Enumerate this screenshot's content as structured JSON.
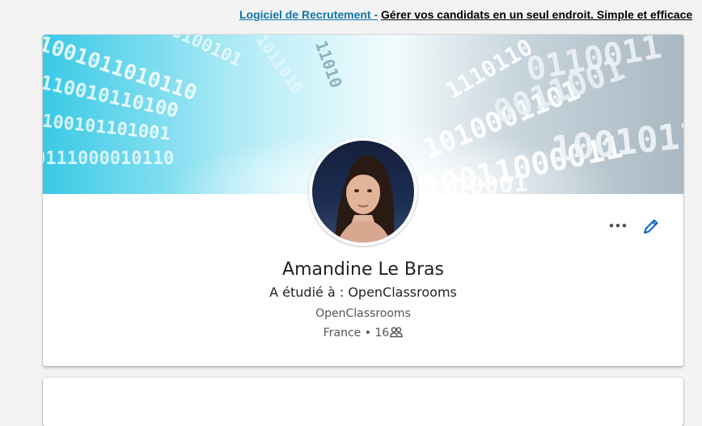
{
  "ad": {
    "link_text": "Logiciel de Recrutement -",
    "text": "Gérer vos candidats en un seul endroit. Simple et efficace"
  },
  "banner": {
    "icon": "binary-tunnel-image",
    "digits_light": "1001110011100",
    "digits_right": "1001100011"
  },
  "profile": {
    "name": "Amandine Le Bras",
    "headline": "A étudié à : OpenClassrooms",
    "school": "OpenClassrooms",
    "location": "France",
    "separator": "•",
    "connections": "16"
  },
  "actions": {
    "more_icon": "more-horizontal-icon",
    "edit_icon": "pencil-icon"
  },
  "colors": {
    "accent": "#0a66c2",
    "background": "#f3f3f3"
  }
}
